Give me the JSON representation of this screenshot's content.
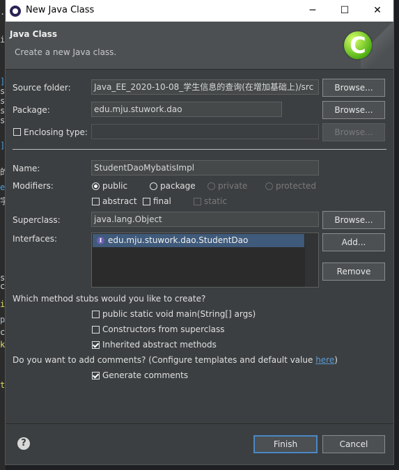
{
  "window": {
    "title": "New Java Class",
    "minimize_glyph": "─",
    "maximize_glyph": "☐",
    "close_glyph": "✕"
  },
  "header": {
    "title": "Java Class",
    "subtitle": "Create a new Java class.",
    "logo_letter": "C"
  },
  "form": {
    "source_folder": {
      "label": "Source folder:",
      "value": "Java_EE_2020-10-08_学生信息的查询(在增加基础上)/src",
      "button": "Browse..."
    },
    "package": {
      "label": "Package:",
      "value": "edu.mju.stuwork.dao",
      "button": "Browse..."
    },
    "enclosing_type": {
      "label": "Enclosing type:",
      "value": "",
      "checked": false,
      "button": "Browse..."
    },
    "name": {
      "label": "Name:",
      "value": "StudentDaoMybatisImpl"
    },
    "modifiers": {
      "label": "Modifiers:",
      "radios": [
        "public",
        "package",
        "private",
        "protected"
      ],
      "selected": "public",
      "checkboxes": [
        "abstract",
        "final",
        "static"
      ]
    },
    "superclass": {
      "label": "Superclass:",
      "value": "java.lang.Object",
      "button": "Browse..."
    },
    "interfaces": {
      "label": "Interfaces:",
      "items": [
        "edu.mju.stuwork.dao.StudentDao"
      ],
      "add_button": "Add...",
      "remove_button": "Remove"
    }
  },
  "stubs": {
    "question": "Which method stubs would you like to create?",
    "options": [
      {
        "label": "public static void main(String[] args)",
        "checked": false
      },
      {
        "label": "Constructors from superclass",
        "checked": false
      },
      {
        "label": "Inherited abstract methods",
        "checked": true
      }
    ]
  },
  "comments": {
    "question_prefix": "Do you want to add comments? (Configure templates and default value ",
    "link": "here",
    "question_suffix": ")",
    "option": {
      "label": "Generate comments",
      "checked": true
    }
  },
  "footer": {
    "help": "?",
    "finish": "Finish",
    "cancel": "Cancel"
  },
  "background_editor": {
    "chars": [
      ".",
      "i",
      "]",
      "s",
      "s",
      "s",
      "s",
      "]",
      "的",
      "e",
      "字",
      "s",
      "c",
      "i",
      "p",
      "c",
      "k",
      "t"
    ]
  }
}
